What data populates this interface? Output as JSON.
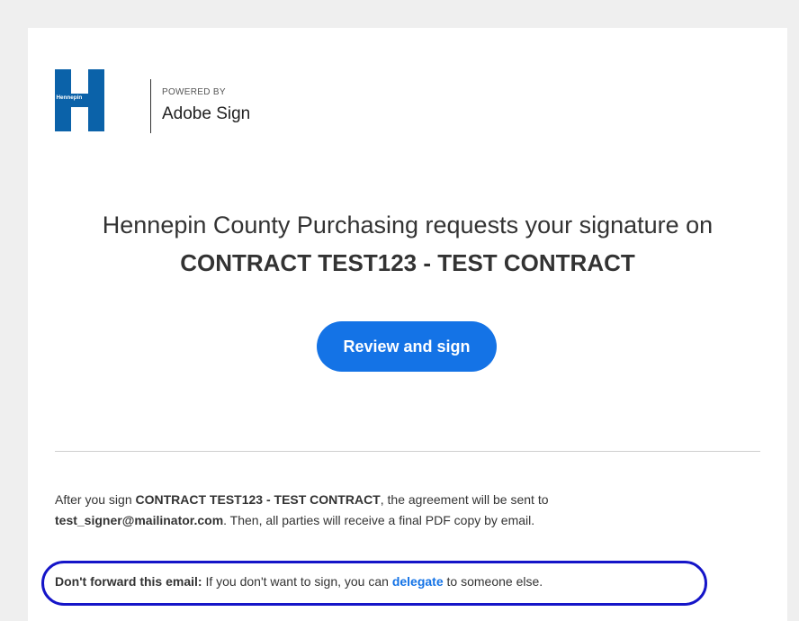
{
  "logo": {
    "brand_text": "Hennepin",
    "powered_by": "POWERED BY",
    "product": "Adobe Sign",
    "brand_color": "#0b62a9"
  },
  "email": {
    "headline": "Hennepin County Purchasing requests your signature on",
    "contract_title": "CONTRACT TEST123 - TEST CONTRACT",
    "cta_label": "Review and sign",
    "info": {
      "p1": "After you sign ",
      "contract": "CONTRACT TEST123 - TEST CONTRACT",
      "p2": ", the agreement will be sent to ",
      "email": "test_signer@mailinator.com",
      "p3": ". Then, all parties will receive a final PDF copy by email."
    },
    "forward": {
      "lead": "Don't forward this email:",
      "p1": " If you don't want to sign, you can ",
      "link": "delegate",
      "p2": " to someone else."
    }
  },
  "colors": {
    "accent": "#1473e6",
    "annotation_oval": "#1515c8"
  }
}
